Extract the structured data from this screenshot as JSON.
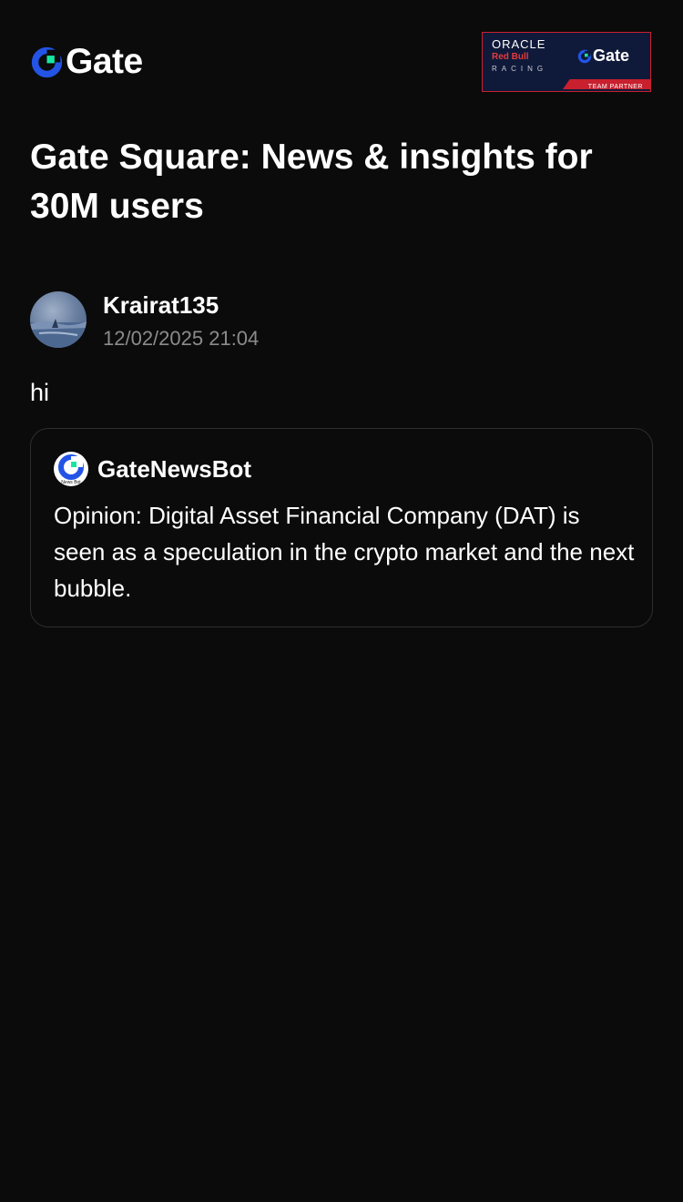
{
  "header": {
    "brand": "Gate",
    "brand_icon": "gate-logo-icon",
    "partner_badge": {
      "oracle": "ORACLE",
      "redbull": "Red Bull",
      "racing": "RACING",
      "gate": "Gate",
      "team_partner": "TEAM PARTNER"
    }
  },
  "page": {
    "title": "Gate Square: News & insights for 30M users"
  },
  "post": {
    "author": "Krairat135",
    "timestamp": "12/02/2025 21:04",
    "body": "hi",
    "quote": {
      "source": "GateNewsBot",
      "source_icon_caption": "News Bot",
      "text": "Opinion: Digital Asset Financial Company (DAT) is seen as a speculation in the crypto market and the next bubble."
    }
  },
  "colors": {
    "background": "#0b0b0b",
    "brand_blue": "#2354e6",
    "brand_green": "#17e6a1",
    "muted_text": "#8b8b8b",
    "card_border": "#2e2e2e"
  }
}
